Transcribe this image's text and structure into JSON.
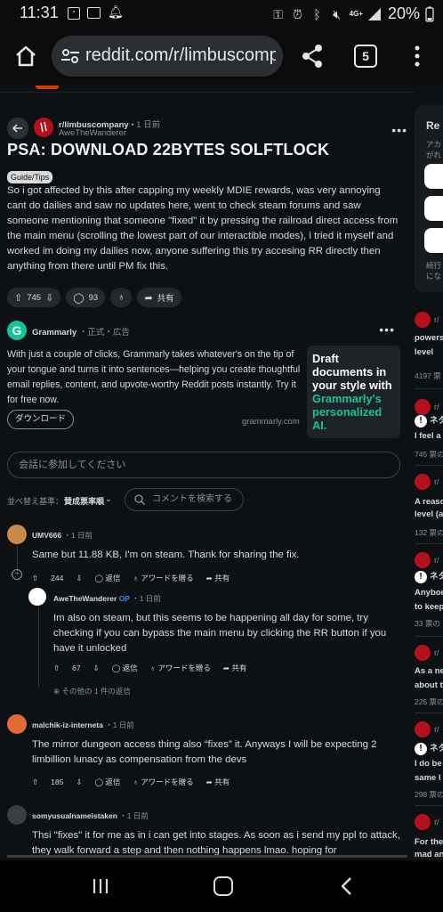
{
  "status_bar": {
    "time": "11:31",
    "network": "4G+",
    "battery": "20%",
    "left_icons": [
      "data-saver-icon",
      "image-icon",
      "notification-bell-icon"
    ],
    "right_icons": [
      "key-icon",
      "alarm-icon",
      "bluetooth-icon",
      "mute-icon",
      "signal-icon",
      "battery-icon"
    ]
  },
  "browser": {
    "url": "reddit.com/r/limbuscompany",
    "tab_count": "5"
  },
  "post": {
    "subreddit": "r/limbuscompany",
    "time": "1 日前",
    "author": "AweTheWanderer",
    "title": "PSA: DOWNLOAD 22BYTES SOLFTLOCK",
    "flair": "Guide/Tips",
    "body": "So i got affected by this after capping my weekly MDIE rewards, was very annoying cant do dailies and saw no updates here, went to check steam forums and saw someone mentioning that someone \"fixed\" it by pressing the railroad direct access from the main menu (scrolling the lowest part of our interactible modes), i tried it myself and worked im doing my dailies now, anyone suffering this try accesing RR directly then anything from there until PM fix this.",
    "upvotes": "745",
    "comments": "93",
    "share_label": "共有"
  },
  "ad": {
    "brand": "Grammarly",
    "meta": "・正式・広告",
    "text": "With just a couple of clicks, Grammarly takes whatever's on the tip of your tongue and turns it into sentences—helping you create thoughtful email replies, content, and upvote-worthy Reddit posts instantly. Try it for free now.",
    "cta": "ダウンロード",
    "domain": "grammarly.com",
    "image_line1": "Draft documents in your style with",
    "image_line2": "Grammarly's personalized AI.",
    "brand_color": "#15c39a"
  },
  "join_placeholder": "会話に参加してください",
  "sort": {
    "label": "並べ替え基準：",
    "value": "賛成票率順",
    "search_placeholder": "コメントを検索する"
  },
  "labels": {
    "reply": "返信",
    "award": "アワードを贈る",
    "share": "共有",
    "more_replies": "その他の 1 件の返信",
    "op": "OP"
  },
  "comments": [
    {
      "user": "UMV666",
      "time": "・1 日前",
      "body": "Same but 11.88 KB, I'm on steam. Thank for sharing the fix.",
      "votes": "244"
    },
    {
      "user": "AweTheWanderer",
      "time": "・1 日前",
      "body": "Im also on steam, but this seems to be happening all day for some, try checking if you can bypass the main menu by clicking the RR button if you have it unlocked",
      "votes": "67"
    },
    {
      "user": "malchik-iz-interneta",
      "time": "・1 日前",
      "body": "The mirror dungeon access thing also “fixes” it. Anyways I will be expecting 2 limbillion lunacy as compensation from the devs",
      "votes": "185"
    },
    {
      "user": "somyusualnameistaken",
      "time": "・1 日前",
      "body": "Thsi \"fixes\" it for me as in i can get into stages. As soon as i send my ppl to attack, they walk forward a step and then nothing happens lmao. hoping for",
      "votes": ""
    }
  ],
  "right_column": {
    "card_title": "Re",
    "card_line1": "アカ",
    "card_line2": "がれ",
    "card_line3": "続行",
    "card_line4": "にな",
    "items": [
      {
        "sub": "r/",
        "title1": "powers",
        "title2": "level",
        "votes": "4197 票"
      },
      {
        "sub": "r/",
        "tag": "ネタ",
        "title1": "I feel a",
        "votes": "745 票の"
      },
      {
        "sub": "r/",
        "title1": "A reaso",
        "title2": "level (a",
        "votes": "132 票の"
      },
      {
        "sub": "r/",
        "tag": "ネタ",
        "title1": "Anybod",
        "title2": "to keep",
        "votes": "33 票の"
      },
      {
        "sub": "r/",
        "title1": "As a ne",
        "title2": "about t",
        "votes": "225 票の"
      },
      {
        "sub": "r/",
        "tag": "ネタ",
        "title1": "I do be",
        "title2": "same l",
        "votes": "298 票の"
      },
      {
        "sub": "r/",
        "title1": "For the",
        "title2": "mad an"
      }
    ]
  }
}
